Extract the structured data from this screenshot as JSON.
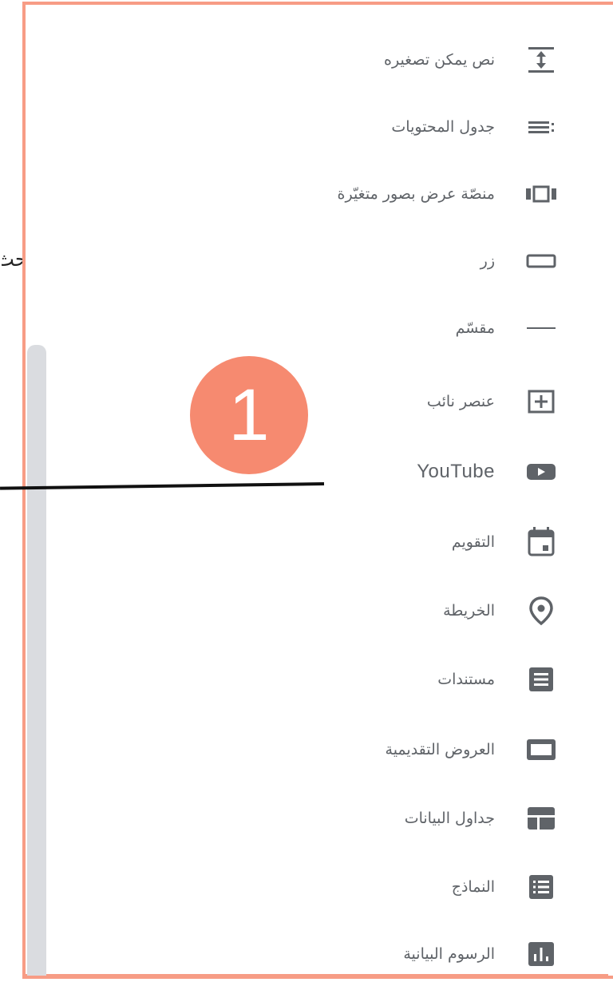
{
  "side_text": "بحث",
  "badge_number": "1",
  "menu": {
    "items": [
      {
        "label": "نص يمكن تصغيره",
        "icon": "collapsible-text-icon"
      },
      {
        "label": "جدول المحتويات",
        "icon": "table-of-contents-icon"
      },
      {
        "label": "منصّة عرض بصور متغيّرة",
        "icon": "carousel-icon"
      },
      {
        "label": "زر",
        "icon": "button-icon"
      },
      {
        "label": "مقسّم",
        "icon": "divider-icon"
      },
      {
        "label": "عنصر نائب",
        "icon": "placeholder-icon"
      },
      {
        "label": "YouTube",
        "icon": "youtube-icon"
      },
      {
        "label": "التقويم",
        "icon": "calendar-icon"
      },
      {
        "label": "الخريطة",
        "icon": "map-pin-icon"
      },
      {
        "label": "مستندات",
        "icon": "docs-icon"
      },
      {
        "label": "العروض التقديمية",
        "icon": "slides-icon"
      },
      {
        "label": "جداول البيانات",
        "icon": "sheets-icon"
      },
      {
        "label": "النماذج",
        "icon": "forms-icon"
      },
      {
        "label": "الرسوم البيانية",
        "icon": "charts-icon"
      }
    ]
  },
  "colors": {
    "frame": "#f79c85",
    "badge": "#f68a70",
    "icon": "#5f6368",
    "scrollbar": "#dadce0"
  }
}
